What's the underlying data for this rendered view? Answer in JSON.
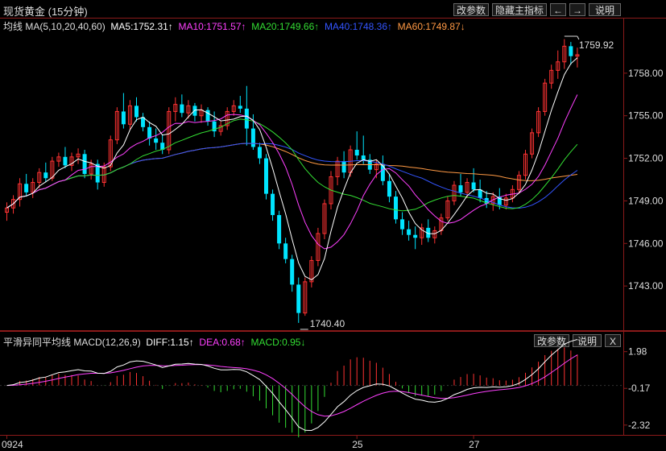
{
  "header": {
    "title": "现货黄金 (15分钟)",
    "buttons": {
      "params": "改参数",
      "hide": "隐藏主指标",
      "left": "←",
      "right": "→",
      "help": "说明"
    }
  },
  "ma_legend": {
    "name": "均线 MA(5,10,20,40,60)",
    "ma5": "MA5:1752.31↑",
    "ma10": "MA10:1751.57↑",
    "ma20": "MA20:1749.66↑",
    "ma40": "MA40:1748.36↑",
    "ma60": "MA60:1749.87↓"
  },
  "macd_legend": {
    "name": "平滑异同平均线 MACD(12,26,9)",
    "diff": "DIFF:1.15↑",
    "dea": "DEA:0.68↑",
    "macd": "MACD:0.95↓",
    "buttons": {
      "params": "改参数",
      "help": "说明",
      "close": "X"
    }
  },
  "colors": {
    "up": "#ff3232",
    "down": "#00e5ff",
    "ma5": "#ffffff",
    "ma10": "#ff40ff",
    "ma20": "#33dd33",
    "ma40": "#3355ff",
    "ma60": "#ff9944",
    "diff": "#ffffff",
    "dea": "#ff40ff",
    "bar_pos": "#ff3232",
    "bar_neg": "#33dd33",
    "border": "#8b1a1a"
  },
  "chart_data": [
    {
      "type": "candlestick",
      "title": "现货黄金 (15分钟)",
      "y_ticks": [
        1743.0,
        1746.0,
        1749.0,
        1752.0,
        1755.0,
        1758.0
      ],
      "y_tick_labels": [
        "1743.00",
        "1746.00",
        "1749.00",
        "1752.00",
        "1755.00",
        "1758.00"
      ],
      "ylim": [
        1740.0,
        1761.0
      ],
      "x_labels": [
        {
          "index": 0,
          "label": "0924"
        },
        {
          "index": 54,
          "label": "25"
        },
        {
          "index": 72,
          "label": "27"
        }
      ],
      "annotations": [
        {
          "label": "1759.92",
          "index": 87,
          "value": 1759.92
        },
        {
          "label": "1740.40",
          "index": 45,
          "value": 1740.4
        }
      ],
      "candles": [
        [
          1748.2,
          1748.9,
          1747.6,
          1748.5
        ],
        [
          1748.5,
          1749.4,
          1748.1,
          1749.1
        ],
        [
          1749.1,
          1750.6,
          1748.6,
          1750.2
        ],
        [
          1750.2,
          1750.9,
          1749.3,
          1749.6
        ],
        [
          1749.6,
          1750.6,
          1749.2,
          1750.3
        ],
        [
          1750.3,
          1751.3,
          1749.9,
          1751.0
        ],
        [
          1751.0,
          1751.7,
          1750.3,
          1750.6
        ],
        [
          1750.6,
          1752.1,
          1750.4,
          1751.8
        ],
        [
          1751.8,
          1752.4,
          1751.4,
          1752.1
        ],
        [
          1752.1,
          1752.8,
          1751.3,
          1751.5
        ],
        [
          1751.5,
          1752.4,
          1751.1,
          1752.1
        ],
        [
          1752.1,
          1752.7,
          1751.6,
          1752.3
        ],
        [
          1752.3,
          1752.6,
          1750.6,
          1750.9
        ],
        [
          1750.9,
          1751.9,
          1750.5,
          1751.6
        ],
        [
          1751.6,
          1751.9,
          1749.8,
          1750.3
        ],
        [
          1750.3,
          1751.7,
          1750.0,
          1751.4
        ],
        [
          1751.4,
          1753.6,
          1751.1,
          1753.3
        ],
        [
          1753.3,
          1755.6,
          1753.0,
          1755.3
        ],
        [
          1755.3,
          1756.6,
          1754.1,
          1754.4
        ],
        [
          1754.4,
          1756.1,
          1754.0,
          1755.7
        ],
        [
          1755.7,
          1756.3,
          1754.6,
          1754.9
        ],
        [
          1754.9,
          1755.2,
          1753.9,
          1754.2
        ],
        [
          1754.2,
          1754.6,
          1752.9,
          1753.4
        ],
        [
          1753.4,
          1754.1,
          1752.6,
          1753.1
        ],
        [
          1753.1,
          1753.7,
          1752.3,
          1752.6
        ],
        [
          1752.6,
          1755.6,
          1752.3,
          1755.3
        ],
        [
          1755.3,
          1756.3,
          1754.6,
          1755.8
        ],
        [
          1755.8,
          1756.5,
          1754.9,
          1755.2
        ],
        [
          1755.2,
          1756.1,
          1754.8,
          1755.7
        ],
        [
          1755.7,
          1755.9,
          1754.6,
          1755.0
        ],
        [
          1755.0,
          1755.8,
          1754.5,
          1755.4
        ],
        [
          1755.4,
          1755.6,
          1754.3,
          1754.6
        ],
        [
          1754.6,
          1755.3,
          1753.5,
          1753.9
        ],
        [
          1753.9,
          1754.6,
          1753.6,
          1754.3
        ],
        [
          1754.3,
          1755.6,
          1754.0,
          1755.3
        ],
        [
          1755.3,
          1756.1,
          1755.0,
          1755.7
        ],
        [
          1755.7,
          1756.4,
          1755.2,
          1755.5
        ],
        [
          1755.5,
          1757.1,
          1752.9,
          1754.1
        ],
        [
          1754.1,
          1755.1,
          1752.6,
          1752.8
        ],
        [
          1752.8,
          1753.1,
          1751.6,
          1752.0
        ],
        [
          1752.0,
          1752.3,
          1749.1,
          1749.5
        ],
        [
          1749.5,
          1749.8,
          1747.6,
          1748.0
        ],
        [
          1748.0,
          1748.3,
          1745.6,
          1746.0
        ],
        [
          1746.0,
          1746.4,
          1744.6,
          1744.9
        ],
        [
          1744.9,
          1745.2,
          1742.6,
          1743.1
        ],
        [
          1743.1,
          1743.6,
          1740.4,
          1741.1
        ],
        [
          1741.1,
          1743.6,
          1740.9,
          1743.3
        ],
        [
          1743.3,
          1745.1,
          1742.9,
          1744.8
        ],
        [
          1744.8,
          1747.1,
          1744.4,
          1746.7
        ],
        [
          1746.7,
          1749.1,
          1746.3,
          1748.8
        ],
        [
          1748.8,
          1751.1,
          1748.4,
          1750.7
        ],
        [
          1750.7,
          1752.1,
          1750.1,
          1751.8
        ],
        [
          1751.8,
          1752.5,
          1750.6,
          1751.0
        ],
        [
          1751.0,
          1752.9,
          1750.7,
          1752.6
        ],
        [
          1752.6,
          1753.9,
          1751.9,
          1752.2
        ],
        [
          1752.2,
          1753.6,
          1751.6,
          1751.9
        ],
        [
          1751.9,
          1752.3,
          1750.9,
          1751.2
        ],
        [
          1751.2,
          1751.9,
          1750.6,
          1751.6
        ],
        [
          1751.6,
          1752.2,
          1750.1,
          1750.4
        ],
        [
          1750.4,
          1750.9,
          1748.9,
          1749.3
        ],
        [
          1749.3,
          1749.7,
          1747.4,
          1747.7
        ],
        [
          1747.7,
          1748.2,
          1746.6,
          1747.0
        ],
        [
          1747.0,
          1747.6,
          1746.2,
          1746.6
        ],
        [
          1746.6,
          1747.2,
          1745.6,
          1746.4
        ],
        [
          1746.4,
          1747.4,
          1745.9,
          1747.1
        ],
        [
          1747.1,
          1747.7,
          1746.1,
          1746.4
        ],
        [
          1746.4,
          1747.2,
          1746.0,
          1746.9
        ],
        [
          1746.9,
          1748.1,
          1746.6,
          1747.8
        ],
        [
          1747.8,
          1749.3,
          1747.6,
          1749.0
        ],
        [
          1749.0,
          1750.4,
          1748.7,
          1750.1
        ],
        [
          1750.1,
          1750.9,
          1749.3,
          1749.6
        ],
        [
          1749.6,
          1750.6,
          1749.2,
          1750.3
        ],
        [
          1750.3,
          1751.3,
          1749.6,
          1749.8
        ],
        [
          1749.8,
          1750.5,
          1748.9,
          1749.2
        ],
        [
          1749.2,
          1749.7,
          1748.5,
          1748.8
        ],
        [
          1748.8,
          1749.6,
          1748.3,
          1749.3
        ],
        [
          1749.3,
          1749.9,
          1748.4,
          1748.7
        ],
        [
          1748.7,
          1749.5,
          1748.4,
          1749.2
        ],
        [
          1749.2,
          1750.1,
          1748.9,
          1749.8
        ],
        [
          1749.8,
          1751.1,
          1749.5,
          1750.8
        ],
        [
          1750.8,
          1752.6,
          1750.5,
          1752.3
        ],
        [
          1752.3,
          1754.1,
          1752.0,
          1753.8
        ],
        [
          1753.8,
          1755.6,
          1753.5,
          1755.3
        ],
        [
          1755.3,
          1757.6,
          1755.0,
          1757.3
        ],
        [
          1757.3,
          1758.6,
          1756.9,
          1758.2
        ],
        [
          1758.2,
          1759.6,
          1757.6,
          1758.8
        ],
        [
          1758.8,
          1760.4,
          1758.3,
          1759.9
        ],
        [
          1759.9,
          1760.2,
          1758.6,
          1759.2
        ],
        [
          1759.2,
          1759.8,
          1758.4,
          1759.3
        ]
      ],
      "series": [
        {
          "name": "MA5",
          "value": 1752.31
        },
        {
          "name": "MA10",
          "value": 1751.57
        },
        {
          "name": "MA20",
          "value": 1749.66
        },
        {
          "name": "MA40",
          "value": 1748.36
        },
        {
          "name": "MA60",
          "value": 1749.87
        }
      ]
    },
    {
      "type": "bar",
      "title": "平滑异同平均线 MACD(12,26,9)",
      "y_ticks": [
        1.98,
        -0.17,
        -2.32
      ],
      "y_tick_labels": [
        "1.98",
        "-0.17",
        "-2.32"
      ],
      "ylim": [
        -2.8,
        2.2
      ],
      "series": [
        {
          "name": "DIFF",
          "value": 1.15
        },
        {
          "name": "DEA",
          "value": 0.68
        },
        {
          "name": "MACD",
          "value": 0.95
        }
      ]
    }
  ]
}
